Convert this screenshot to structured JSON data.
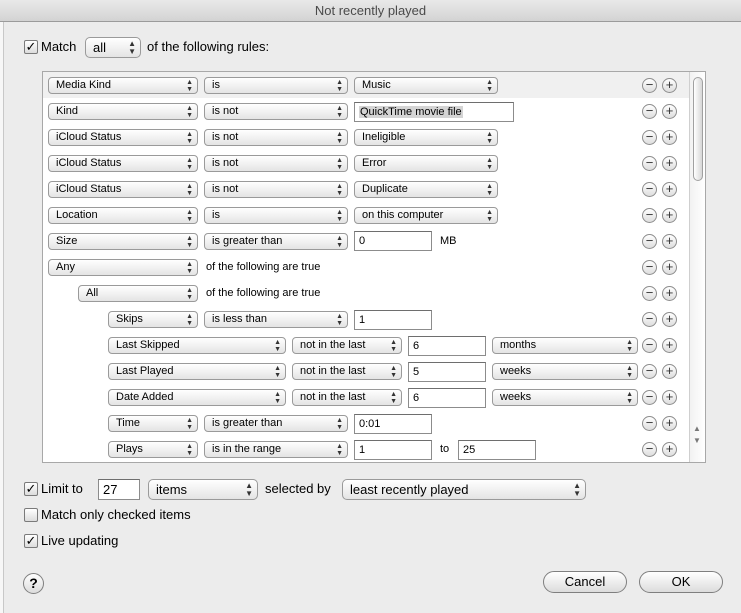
{
  "window": {
    "title": "Not recently played"
  },
  "match": {
    "label": "Match",
    "mode": "all",
    "suffix": "of the following rules:"
  },
  "glyphs": {
    "check": "✓",
    "updown": "▲▼",
    "minus": "−",
    "plus": "+",
    "scroll_up": "▲",
    "scroll_down": "▼"
  },
  "rules": {
    "r1": {
      "field": "Media Kind",
      "op": "is",
      "value": "Music"
    },
    "r2": {
      "field": "Kind",
      "op": "is not",
      "value": "QuickTime movie file"
    },
    "r3": {
      "field": "iCloud Status",
      "op": "is not",
      "value": "Ineligible"
    },
    "r4": {
      "field": "iCloud Status",
      "op": "is not",
      "value": "Error"
    },
    "r5": {
      "field": "iCloud Status",
      "op": "is not",
      "value": "Duplicate"
    },
    "r6": {
      "field": "Location",
      "op": "is",
      "value": "on this computer"
    },
    "r7": {
      "field": "Size",
      "op": "is greater than",
      "value": "0",
      "unit": "MB"
    },
    "r8": {
      "field": "Any",
      "suffix": "of the following are true"
    },
    "r9": {
      "field": "All",
      "suffix": "of the following are true"
    },
    "r10": {
      "field": "Skips",
      "op": "is less than",
      "value": "1"
    },
    "r11": {
      "field": "Last Skipped",
      "op": "not in the last",
      "value": "6",
      "unit": "months"
    },
    "r12": {
      "field": "Last Played",
      "op": "not in the last",
      "value": "5",
      "unit": "weeks"
    },
    "r13": {
      "field": "Date Added",
      "op": "not in the last",
      "value": "6",
      "unit": "weeks"
    },
    "r14": {
      "field": "Time",
      "op": "is greater than",
      "value": "0:01"
    },
    "r15": {
      "field": "Plays",
      "op": "is in the range",
      "value": "1",
      "to": "to",
      "value2": "25"
    }
  },
  "limit": {
    "label": "Limit to",
    "value": "27",
    "unit": "items",
    "selected_by_label": "selected by",
    "selected_by": "least recently played"
  },
  "match_checked": {
    "label": "Match only checked items"
  },
  "live_updating": {
    "label": "Live updating"
  },
  "help": {
    "label": "?"
  },
  "buttons": {
    "cancel": "Cancel",
    "ok": "OK"
  }
}
